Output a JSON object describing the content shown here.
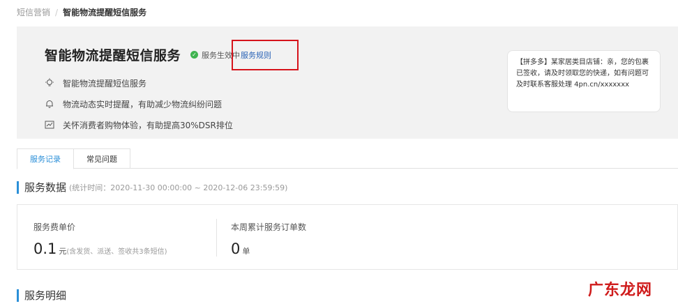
{
  "breadcrumb": {
    "parent": "短信营销",
    "separator": "/",
    "current": "智能物流提醒短信服务"
  },
  "header": {
    "title": "智能物流提醒短信服务",
    "status": "服务生效中",
    "rule_link": "服务规则",
    "highlight_color": "#d6131b"
  },
  "features": [
    {
      "icon": "lightbulb-icon",
      "text": "智能物流提醒短信服务"
    },
    {
      "icon": "bell-icon",
      "text": "物流动态实时提醒，有助减少物流纠纷问题"
    },
    {
      "icon": "chart-icon",
      "text": "关怀消费者购物体验，有助提高30%DSR排位"
    }
  ],
  "sms_preview": "【拼多多】某家居类目店铺：亲，您的包裹已签收，请及时领取您的快递，如有问题可及时联系客服处理 4pn.cn/xxxxxxx",
  "tabs": [
    {
      "label": "服务记录",
      "active": true
    },
    {
      "label": "常见问题",
      "active": false
    }
  ],
  "service_data": {
    "heading": "服务数据",
    "period": "(统计时间：2020-11-30 00:00:00 ~ 2020-12-06 23:59:59)",
    "unit_price": {
      "label": "服务费单价",
      "value": "0.1",
      "unit": "元",
      "note": "(含发货、派送、签收共3条短信)"
    },
    "weekly_orders": {
      "label": "本周累计服务订单数",
      "value": "0",
      "unit": "单"
    }
  },
  "detail_heading": "服务明细",
  "watermark": "广东龙网",
  "accent_color": "#2b8fd8"
}
